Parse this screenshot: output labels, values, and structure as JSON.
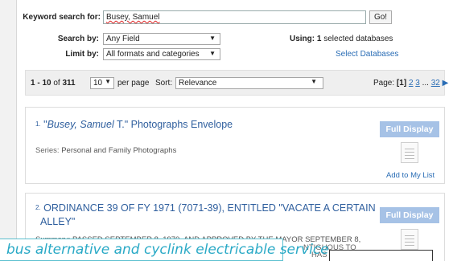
{
  "search": {
    "keyword_label": "Keyword search for:",
    "keyword_value": "Busey, Samuel",
    "go_label": "Go!",
    "searchby_label": "Search by:",
    "searchby_value": "Any Field",
    "limitby_label": "Limit by:",
    "limitby_value": "All formats and categories",
    "using_label": "Using:",
    "using_count": "1",
    "using_suffix": "selected databases",
    "select_db": "Select Databases"
  },
  "toolbar": {
    "range": "1 - 10",
    "of": "of",
    "total": "311",
    "per_value": "10",
    "per_label": "per page",
    "sort_label": "Sort:",
    "sort_value": "Relevance",
    "page_label": "Page:",
    "current_page": "[1]",
    "pages": [
      "2",
      "3",
      "...",
      "32"
    ]
  },
  "results": [
    {
      "num": "1.",
      "title_prefix": "\"",
      "title_em": "Busey, Samuel",
      "title_rest": " T.\" Photographs Envelope",
      "meta_label": "Series:",
      "meta_value": "Personal and Family Photographs",
      "button": "Full Display",
      "add": "Add to My List"
    },
    {
      "num": "2.",
      "title_line1": "ORDINANCE 39 OF FY 1971 (7071-39), ENTITLED \"VACATE A CERTAIN",
      "title_line2": "ALLEY\"",
      "meta_label": "Summary:",
      "meta_value": "PASSED SEPTEMBER 8, 1970, AND APPROVED BY THE MAYOR SEPTEMBER 8,",
      "meta_line2": "NTIGUOUS TO",
      "meta_line3": "HAS VACATED",
      "button": "Full Display",
      "year": "1971"
    }
  ],
  "overlay_text": "bus alternative and cyclink electricable service"
}
